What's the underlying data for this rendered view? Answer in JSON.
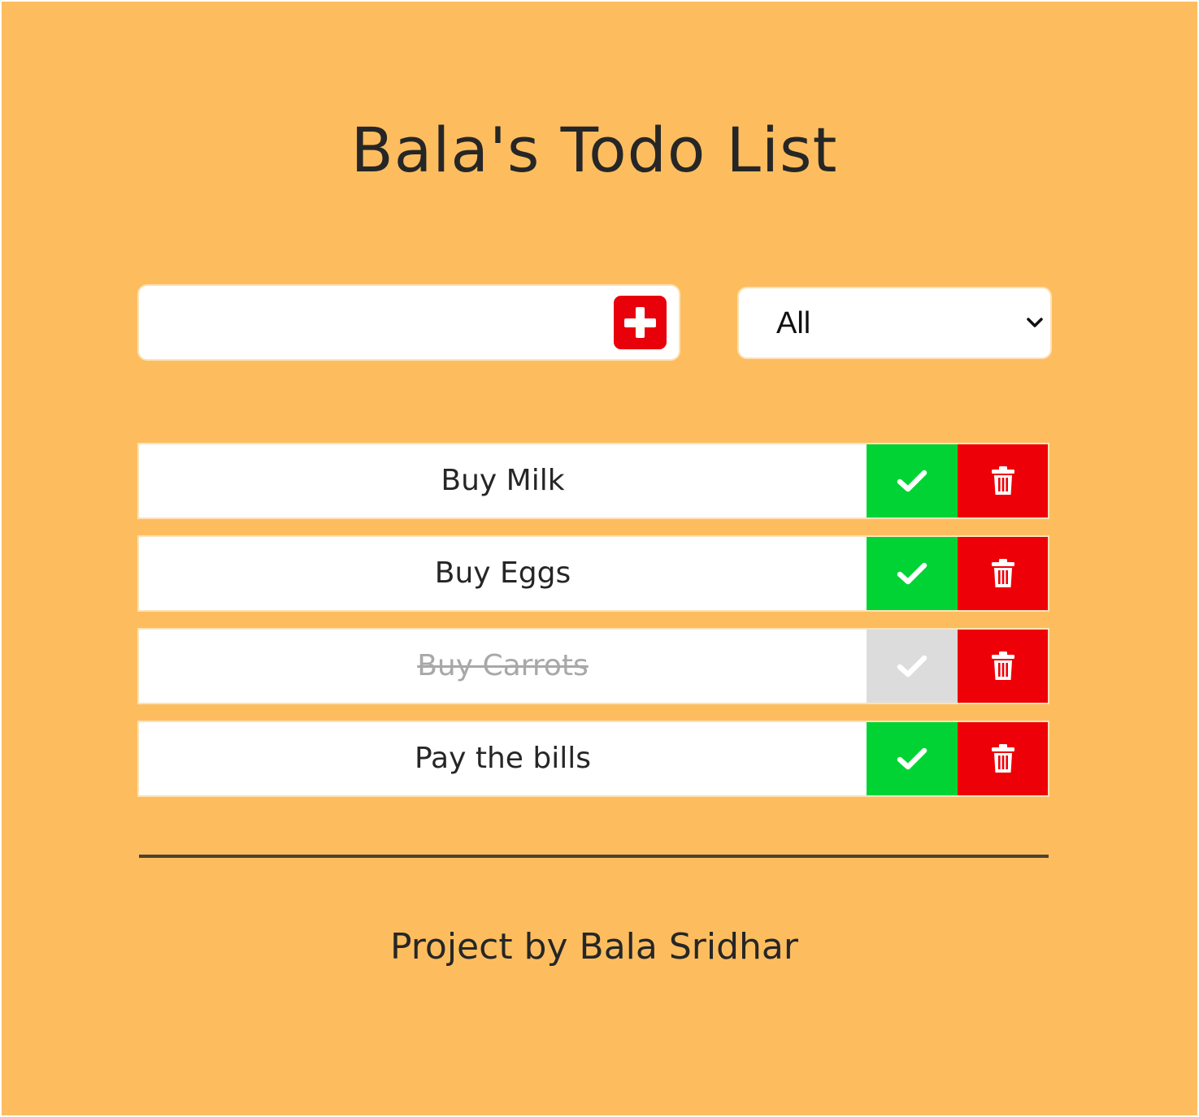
{
  "header": {
    "title": "Bala's Todo List"
  },
  "add_form": {
    "input_value": "",
    "input_placeholder": "",
    "add_icon": "plus-icon"
  },
  "filter": {
    "selected": "All"
  },
  "todos": [
    {
      "text": "Buy Milk",
      "completed": false
    },
    {
      "text": "Buy Eggs",
      "completed": false
    },
    {
      "text": "Buy Carrots",
      "completed": true
    },
    {
      "text": "Pay the bills",
      "completed": false
    }
  ],
  "footer": {
    "credit": "Project by Bala Sridhar"
  },
  "colors": {
    "background": "#fdbd5f",
    "complete": "#00d333",
    "complete_done": "#dcdcdc",
    "trash": "#ee0009",
    "add_button": "#e8000a"
  }
}
